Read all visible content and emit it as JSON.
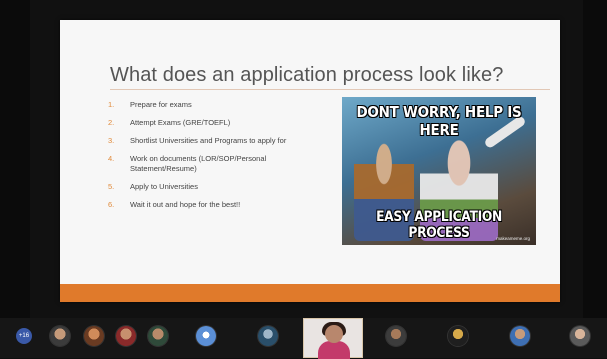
{
  "slide": {
    "title": "What does an application process look like?",
    "steps": [
      {
        "num": "1.",
        "text": "Prepare for exams"
      },
      {
        "num": "2.",
        "text": "Attempt Exams (GRE/TOEFL)"
      },
      {
        "num": "3.",
        "text": "Shortlist Universities and Programs to apply for"
      },
      {
        "num": "4.",
        "text": "Work on documents (LOR/SOP/Personal Statement/Resume)"
      },
      {
        "num": "5.",
        "text": "Apply to Universities"
      },
      {
        "num": "6.",
        "text": "Wait it out and hope for the best!!"
      }
    ],
    "meme": {
      "top_text": "DONT WORRY, HELP IS HERE",
      "bottom_text": "EASY APPLICATION PROCESS",
      "credit": "makeameme.org"
    }
  },
  "gallery": {
    "more_count": "+16"
  },
  "colors": {
    "accent_orange": "#e07a2b",
    "slide_background": "#f7f7f7",
    "gallery_background": "#161616"
  }
}
